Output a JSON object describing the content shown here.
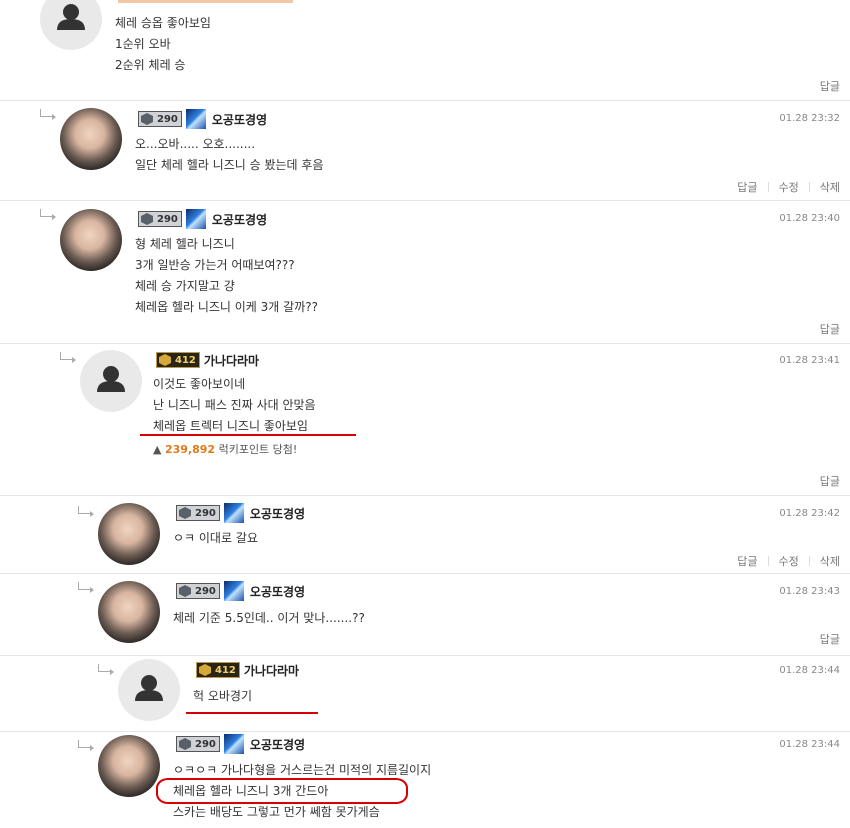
{
  "labels": {
    "reply": "답글",
    "edit": "수정",
    "delete": "삭제"
  },
  "top_comment": {
    "lines": [
      "체레 승옵 좋아보임",
      "1순위 오바",
      "2순위 체레 승"
    ]
  },
  "comments": [
    {
      "id": "c1",
      "level": "290",
      "nick": "오공또경영",
      "time": "01.28 23:32",
      "lines": [
        "오...오바..... 오호........",
        "일단 체레 헬라 니즈니 승 봤는데 후음"
      ]
    },
    {
      "id": "c2",
      "level": "290",
      "nick": "오공또경영",
      "time": "01.28 23:40",
      "lines": [
        "형 체레 헬라 니즈니",
        "3개 일반승 가는거 어때보여???",
        "체레 승 가지말고 걍",
        "체레옵 헬라 니즈니 이케 3개 갈까??"
      ]
    },
    {
      "id": "c3",
      "level": "412",
      "nick": "가나다라마",
      "time": "01.28 23:41",
      "lines": [
        "이것도 좋아보이네",
        "난 니즈니 패스 진짜 사대 안맞음",
        "체레옵 트렉터 니즈니 좋아보임"
      ],
      "points_num": "239,892",
      "points_text": "럭키포인트 당첨!"
    },
    {
      "id": "c4",
      "level": "290",
      "nick": "오공또경영",
      "time": "01.28 23:42",
      "lines": [
        "ㅇㅋ 이대로 갈요"
      ]
    },
    {
      "id": "c5",
      "level": "290",
      "nick": "오공또경영",
      "time": "01.28 23:43",
      "lines": [
        "체레 기준 5.5인데.. 이거 맞나.......??"
      ]
    },
    {
      "id": "c6",
      "level": "412",
      "nick": "가나다라마",
      "time": "01.28 23:44",
      "lines": [
        "헉 오바경기"
      ]
    },
    {
      "id": "c7",
      "level": "290",
      "nick": "오공또경영",
      "time": "01.28 23:44",
      "lines": [
        "ㅇㅋㅇㅋ 가나다형을 거스르는건 미적의 지름길이지",
        "체레옵 헬라 니즈니 3개 간드아",
        "스카는 배당도 그렇고 먼가 쎄함 못가게슴"
      ]
    }
  ],
  "colors": {
    "annotation": "#d60000",
    "points": "#e07b1a"
  }
}
